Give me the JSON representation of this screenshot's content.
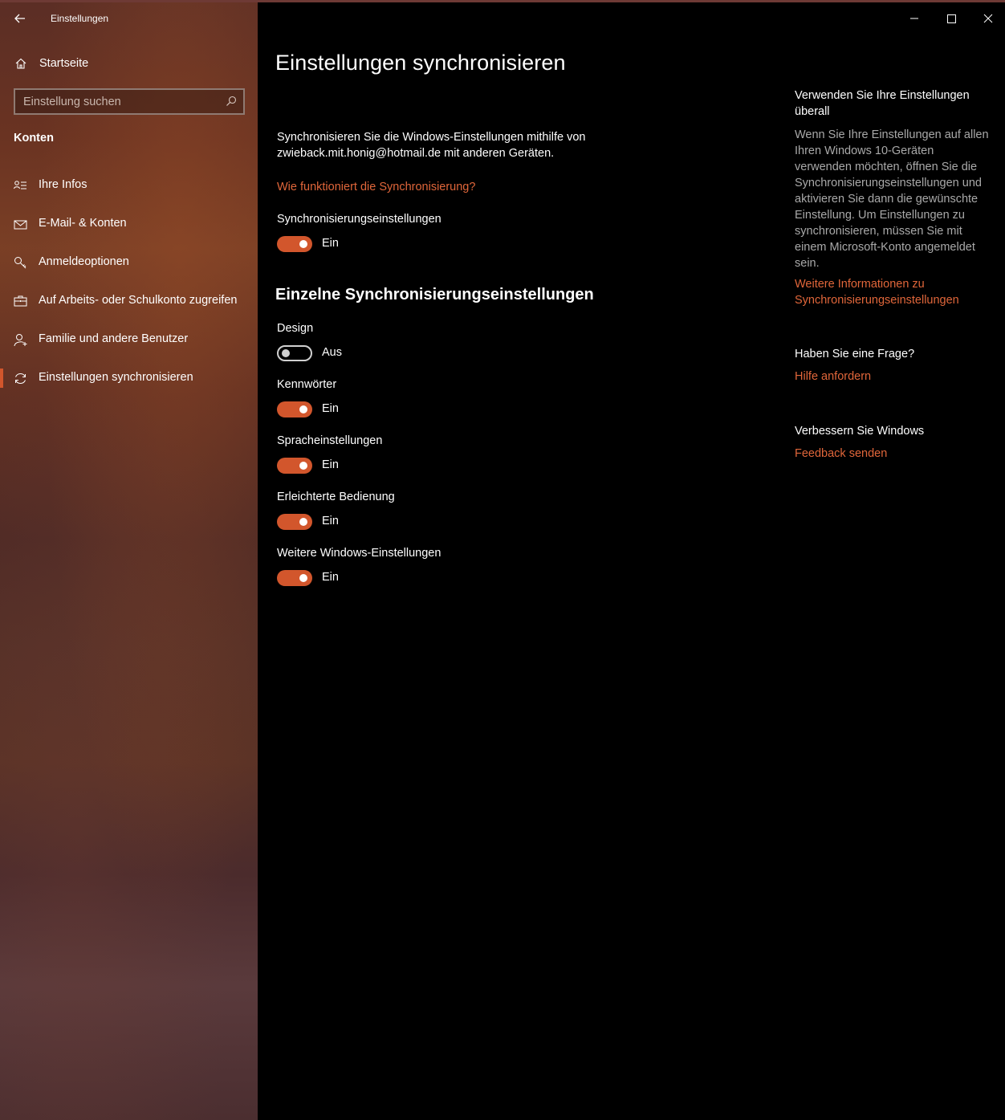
{
  "app": {
    "title": "Einstellungen"
  },
  "sidebar": {
    "home_label": "Startseite",
    "search_placeholder": "Einstellung suchen",
    "section_label": "Konten",
    "items": [
      {
        "label": "Ihre Infos",
        "icon": "person-info-icon"
      },
      {
        "label": "E-Mail- & Konten",
        "icon": "mail-icon"
      },
      {
        "label": "Anmeldeoptionen",
        "icon": "key-icon"
      },
      {
        "label": "Auf Arbeits- oder Schulkonto zugreifen",
        "icon": "briefcase-icon"
      },
      {
        "label": "Familie und andere Benutzer",
        "icon": "add-person-icon"
      },
      {
        "label": "Einstellungen synchronisieren",
        "icon": "sync-icon",
        "active": true
      }
    ]
  },
  "main": {
    "title": "Einstellungen synchronisieren",
    "description": "Synchronisieren Sie die Windows-Einstellungen mithilfe von zwieback.mit.honig@hotmail.de mit anderen Geräten.",
    "how_link": "Wie funktioniert die Synchronisierung?",
    "sync_setting": {
      "label": "Synchronisierungseinstellungen",
      "state": "Ein",
      "on": true
    },
    "individual_heading": "Einzelne Synchronisierungseinstellungen",
    "individual": [
      {
        "label": "Design",
        "state": "Aus",
        "on": false
      },
      {
        "label": "Kennwörter",
        "state": "Ein",
        "on": true
      },
      {
        "label": "Spracheinstellungen",
        "state": "Ein",
        "on": true
      },
      {
        "label": "Erleichterte Bedienung",
        "state": "Ein",
        "on": true
      },
      {
        "label": "Weitere Windows-Einstellungen",
        "state": "Ein",
        "on": true
      }
    ]
  },
  "aside": {
    "use_heading": "Verwenden Sie Ihre Einstellungen überall",
    "use_text": "Wenn Sie Ihre Einstellungen auf allen Ihren Windows 10-Geräten verwenden möchten, öffnen Sie die Synchronisierungseinstellungen und aktivieren Sie dann die gewünschte Einstellung. Um Einstellungen zu synchronisieren, müssen Sie mit einem Microsoft-Konto angemeldet sein.",
    "use_link": "Weitere Informationen zu Synchronisierungseinstellungen",
    "question_heading": "Haben Sie eine Frage?",
    "question_link": "Hilfe anfordern",
    "improve_heading": "Verbessern Sie Windows",
    "improve_link": "Feedback senden"
  },
  "colors": {
    "accent": "#d2562c",
    "link": "#e0663a"
  }
}
